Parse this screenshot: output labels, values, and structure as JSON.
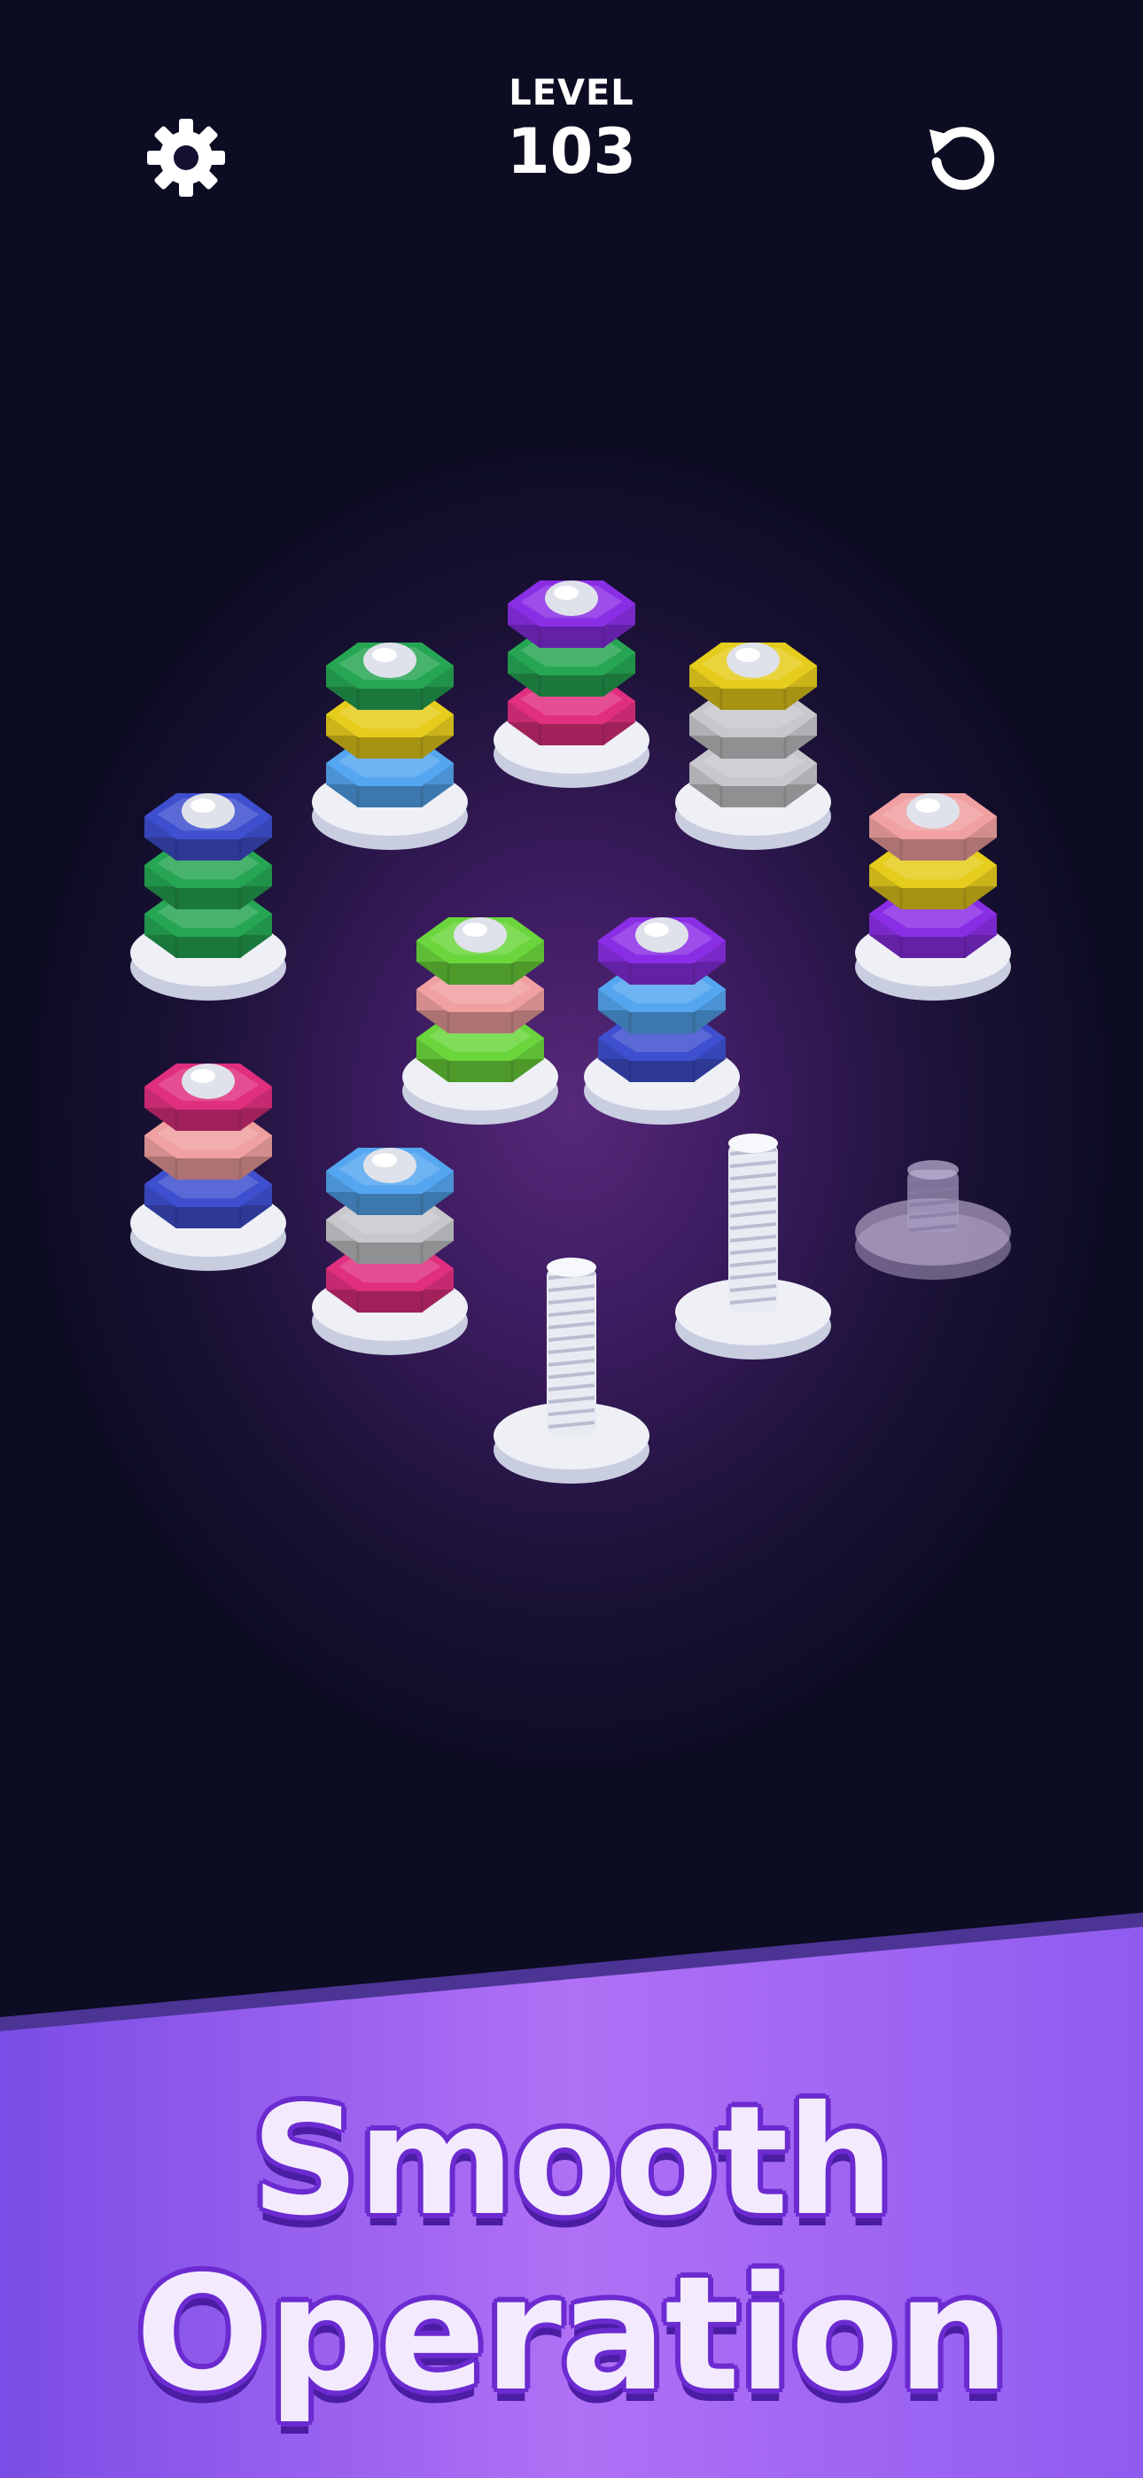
{
  "header": {
    "level_label": "LEVEL",
    "level_number": "103",
    "settings_icon": "gear-icon",
    "restart_icon": "restart-icon"
  },
  "colors": {
    "purple": "#8a2ee6",
    "green": "#26a653",
    "pink": "#e02f7f",
    "yellow": "#e6cc1c",
    "blue": "#54a6f0",
    "gray": "#c8c8cc",
    "navy": "#3e4fcf",
    "salmon": "#f0a0a0",
    "lime": "#6bd63c"
  },
  "board": {
    "pegs": [
      {
        "name": "peg-1",
        "nuts_bottom_to_top": [
          "pink",
          "green",
          "purple"
        ]
      },
      {
        "name": "peg-2",
        "nuts_bottom_to_top": [
          "blue",
          "yellow",
          "green"
        ]
      },
      {
        "name": "peg-3",
        "nuts_bottom_to_top": [
          "gray",
          "gray",
          "yellow"
        ]
      },
      {
        "name": "peg-4",
        "nuts_bottom_to_top": [
          "green",
          "green",
          "navy"
        ]
      },
      {
        "name": "peg-5",
        "nuts_bottom_to_top": [
          "purple",
          "yellow",
          "salmon"
        ]
      },
      {
        "name": "peg-6",
        "nuts_bottom_to_top": [
          "lime",
          "salmon",
          "lime"
        ]
      },
      {
        "name": "peg-7",
        "nuts_bottom_to_top": [
          "navy",
          "blue",
          "purple"
        ]
      },
      {
        "name": "peg-8",
        "nuts_bottom_to_top": [
          "navy",
          "salmon",
          "pink"
        ]
      },
      {
        "name": "peg-9",
        "nuts_bottom_to_top": [
          "pink",
          "gray",
          "blue"
        ]
      },
      {
        "name": "peg-10",
        "nuts_bottom_to_top": []
      },
      {
        "name": "peg-11",
        "nuts_bottom_to_top": []
      },
      {
        "name": "peg-12",
        "nuts_bottom_to_top": [],
        "locked": true
      }
    ]
  },
  "banner": {
    "line1": "Smooth",
    "line2": "Operation"
  }
}
